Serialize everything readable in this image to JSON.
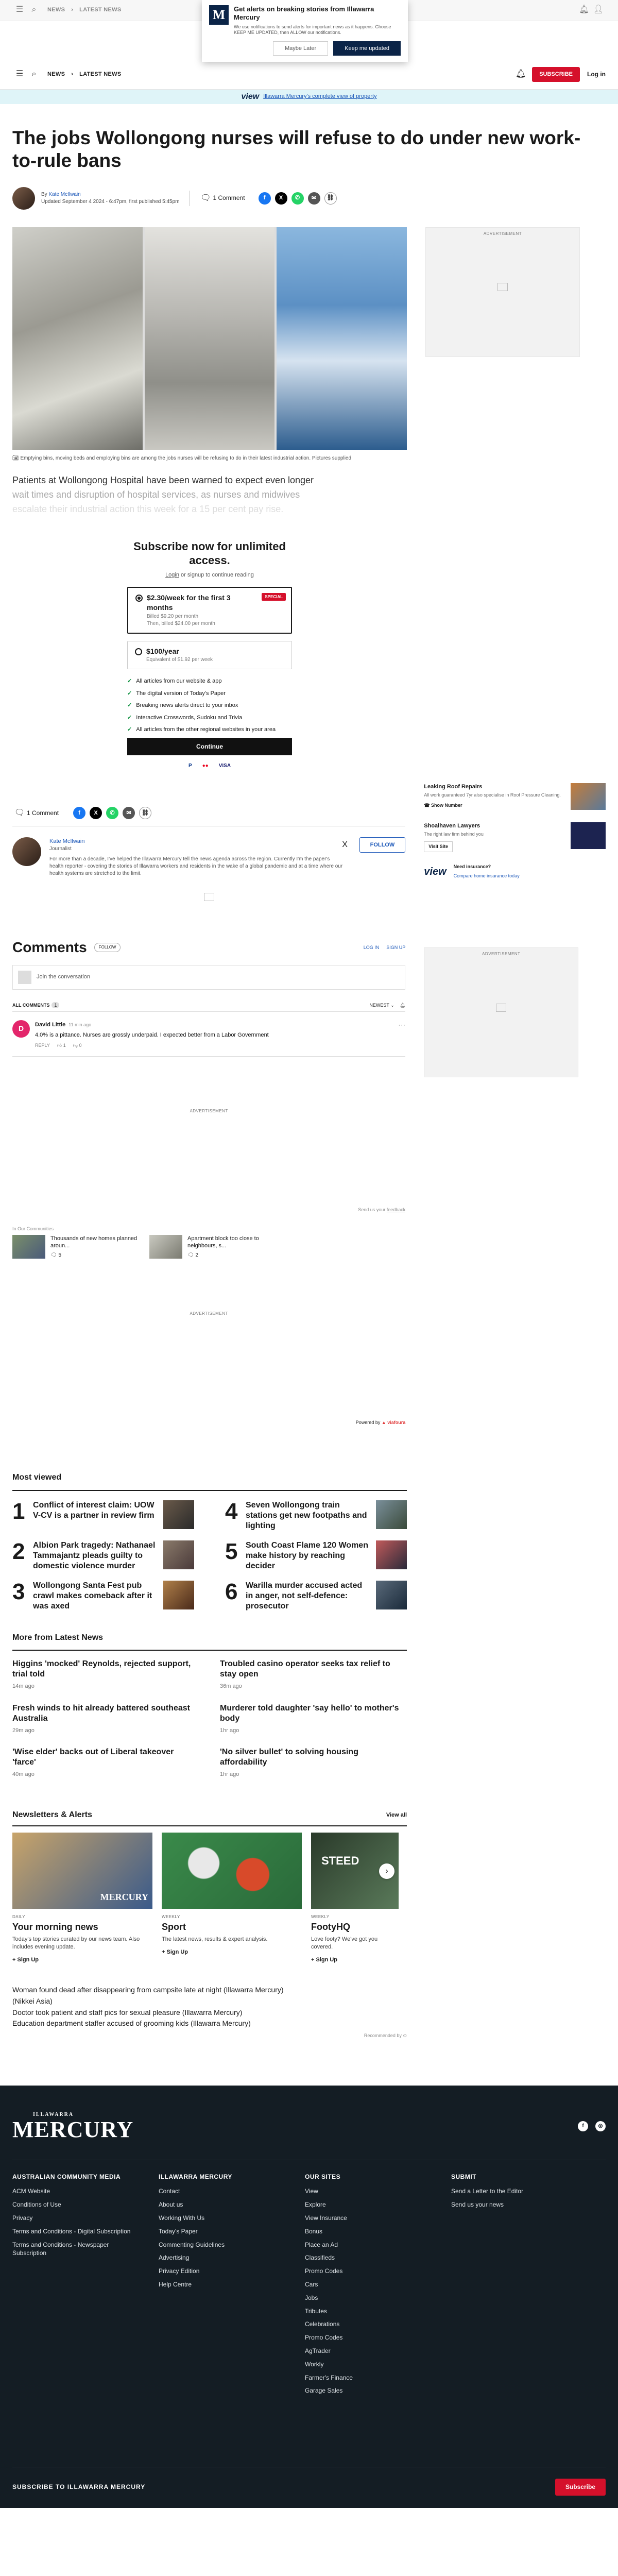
{
  "top_header": {
    "crumb": "NEWS",
    "sep": "›",
    "section": "LATEST NEWS"
  },
  "alert": {
    "logo_letter": "M",
    "title": "Get alerts on breaking stories from Illawarra Mercury",
    "body": "We use notifications to send alerts for important news as it happens. Choose KEEP ME UPDATED, then ALLOW our notifications.",
    "maybe_label": "Maybe Later",
    "keep_label": "Keep me updated"
  },
  "header": {
    "crumb": "NEWS",
    "sep": "›",
    "section": "LATEST NEWS",
    "subscribe_label": "SUBSCRIBE",
    "login_label": "Log in"
  },
  "view_banner": {
    "logo": "view",
    "text_pre": "",
    "link_text": "Illawarra Mercury's complete view of property"
  },
  "article": {
    "headline": "The jobs Wollongong nurses will refuse to do under new work-to-rule bans",
    "by_prefix": "By",
    "author": "Kate McIlwain",
    "updated": "Updated September 4 2024 - 6:47pm, first published 5:45pm",
    "comment_count": "1 Comment",
    "caption": "Emptying bins, moving beds and employing bins are among the jobs nurses will be refusing to do in their latest industrial action. Pictures supplied",
    "lead_1": "Patients at Wollongong Hospital have been warned to expect even longer",
    "lead_2": "wait times and disruption of hospital services, as nurses and midwives",
    "lead_3": "escalate their industrial action this week for a 15 per cent pay rise."
  },
  "paywall": {
    "title": "Subscribe now for unlimited access.",
    "sub_pre": "Login",
    "sub_mid": " or signup to continue reading",
    "plan1": {
      "name": "$2.30/week for the first 3 months",
      "badge": "SPECIAL",
      "d1": "Billed $9.20 per month",
      "d2": "Then, billed $24.00 per month"
    },
    "plan2": {
      "name": "$100/year",
      "d1": "Equivalent of $1.92 per week"
    },
    "features": [
      "All articles from our website & app",
      "The digital version of Today's Paper",
      "Breaking news alerts direct to your inbox",
      "Interactive Crosswords, Sudoku and Trivia",
      "All articles from the other regional websites in your area"
    ],
    "continue_label": "Continue",
    "pay": [
      "P",
      "●●",
      "VISA"
    ]
  },
  "share_row": {
    "comment_count": "1 Comment"
  },
  "author_box": {
    "name": "Kate McIlwain",
    "role": "Journalist",
    "bio": "For more than a decade, I've helped the Illawarra Mercury tell the news agenda across the region. Currently I'm the paper's health reporter - covering the stories of Illawarra workers and residents in the wake of a global pandemic and at a time where our health systems are stretched to the limit.",
    "follow_label": "FOLLOW"
  },
  "comments": {
    "title": "Comments",
    "follow_pill": "FOLLOW",
    "login": "LOG IN",
    "signup": "SIGN UP",
    "join": "Join the conversation",
    "all_label": "ALL COMMENTS",
    "all_count": "1",
    "sort_label": "NEWEST",
    "item": {
      "avatar_letter": "D",
      "author": "David Little",
      "when": "11 min ago",
      "text": "4.0% is a pittance. Nurses are grossly underpaid. I expected better from a Labor Government",
      "reply": "REPLY",
      "up": "1",
      "down": "0"
    }
  },
  "advert_label": "ADVERTISEMENT",
  "feedback": {
    "pre": "Send us your ",
    "link": "feedback"
  },
  "more_on_label": "In Our Communities",
  "mini_cards": [
    {
      "title": "Thousands of new homes planned aroun...",
      "count": "5"
    },
    {
      "title": "Apartment block too close to neighbours, s...",
      "count": "2"
    }
  ],
  "powered_by": {
    "pre": "Powered by",
    "brand": "▲ viafoura"
  },
  "most_viewed": {
    "title": "Most viewed",
    "items": [
      {
        "n": "1",
        "t": "Conflict of interest claim: UOW V-CV is a partner in review firm"
      },
      {
        "n": "4",
        "t": "Seven Wollongong train stations get new footpaths and lighting"
      },
      {
        "n": "2",
        "t": "Albion Park tragedy: Nathanael Tammajantz pleads guilty to domestic violence murder"
      },
      {
        "n": "5",
        "t": "South Coast Flame 120 Women make history by reaching decider"
      },
      {
        "n": "3",
        "t": "Wollongong Santa Fest pub crawl makes comeback after it was axed"
      },
      {
        "n": "6",
        "t": "Warilla murder accused acted in anger, not self-defence: prosecutor"
      }
    ]
  },
  "latest_news": {
    "title": "More from Latest News",
    "items": [
      {
        "t": "Higgins 'mocked' Reynolds, rejected support, trial told",
        "time": "14m ago"
      },
      {
        "t": "Troubled casino operator seeks tax relief to stay open",
        "time": "36m ago"
      },
      {
        "t": "Fresh winds to hit already battered southeast Australia",
        "time": "29m ago"
      },
      {
        "t": "Murderer told daughter 'say hello' to mother's body",
        "time": "1hr ago"
      },
      {
        "t": "'Wise elder' backs out of Liberal takeover 'farce'",
        "time": "40m ago"
      },
      {
        "t": "'No silver bullet' to solving housing affordability",
        "time": "1hr ago"
      }
    ]
  },
  "newsletters": {
    "title": "Newsletters & Alerts",
    "view_all": "View all",
    "items": [
      {
        "kind": "DAILY",
        "name": "Your morning news",
        "desc": "Today's top stories curated by our news team. Also includes evening update.",
        "signup": "+ Sign Up",
        "logo": "MERCURY"
      },
      {
        "kind": "WEEKLY",
        "name": "Sport",
        "desc": "The latest news, results & expert analysis.",
        "signup": "+ Sign Up"
      },
      {
        "kind": "WEEKLY",
        "name": "FootyHQ",
        "desc": "Love footy? We've got you covered.",
        "signup": "+ Sign Up",
        "logo": "STEED"
      }
    ]
  },
  "outbrain": [
    "Woman found dead after disappearing from campsite late at night (Illawarra Mercury)",
    "(Nikkei Asia)",
    "Doctor took patient and staff pics for sexual pleasure (Illawarra Mercury)",
    "Education department staffer accused of grooming kids (Illawarra Mercury)"
  ],
  "recommended_by": "Recommended by",
  "sidebar": {
    "ad_label": "ADVERTISEMENT",
    "roof": {
      "t": "Leaking Roof Repairs",
      "d": "All work guaranteed 7yr also specialise in Roof Pressure Cleaning.",
      "cta": "Show Number"
    },
    "lawyers": {
      "t": "Shoalhaven Lawyers",
      "d": "The right law firm behind you",
      "cta": "Visit Site"
    },
    "insurance": {
      "logo": "view",
      "t": "Need insurance?",
      "link": "Compare home insurance today"
    }
  },
  "footer": {
    "logo_small": "ILLAWARRA",
    "logo_big": "MERCURY",
    "social": [
      "f",
      "◎"
    ],
    "cols": [
      {
        "h": "AUSTRALIAN COMMUNITY MEDIA",
        "items": [
          "ACM Website",
          "Conditions of Use",
          "Privacy",
          "Terms and Conditions - Digital Subscription",
          "Terms and Conditions - Newspaper Subscription"
        ]
      },
      {
        "h": "ILLAWARRA MERCURY",
        "items": [
          "Contact",
          "About us",
          "Working With Us",
          "Today's Paper",
          "Commenting Guidelines",
          "Advertising",
          "Privacy Edition",
          "Help Centre"
        ]
      },
      {
        "h": "OUR SITES",
        "items": [
          "View",
          "Explore",
          "View Insurance",
          "Bonus",
          "Place an Ad",
          "Classifieds",
          "Promo Codes",
          "Cars",
          "Jobs",
          "Tributes",
          "Celebrations",
          "Promo Codes",
          "AgTrader",
          "Workly",
          "Farmer's Finance",
          "Garage Sales"
        ]
      },
      {
        "h": "SUBMIT",
        "items": [
          "Send a Letter to the Editor",
          "Send us your news"
        ]
      }
    ],
    "bottom_label": "SUBSCRIBE TO ILLAWARRA MERCURY",
    "bottom_btn": "Subscribe"
  }
}
